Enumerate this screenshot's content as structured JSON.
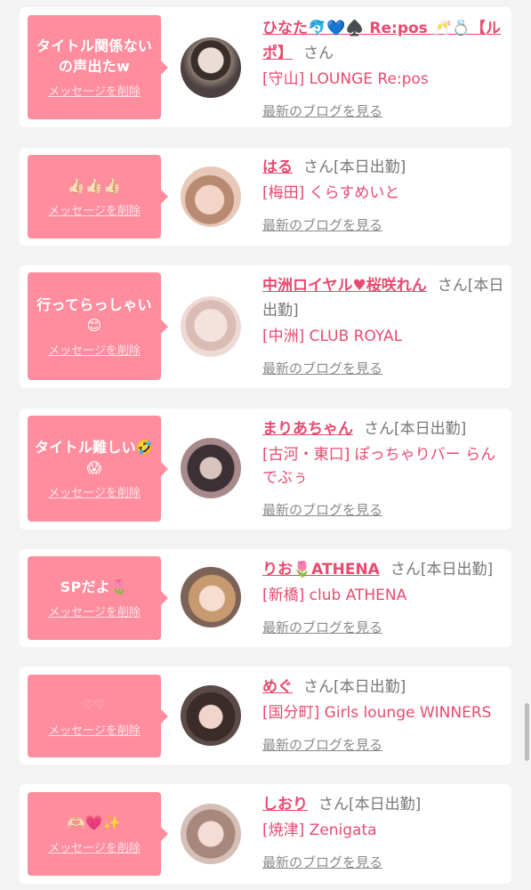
{
  "common": {
    "delete_label": "メッセージを削除",
    "blog_label": "最新のブログを見る",
    "san": "さん"
  },
  "colors": {
    "bubble": "#ff8d9e",
    "name": "#e94a6f",
    "background": "#f3f3f3"
  },
  "messages": [
    {
      "title_lines": [
        "タイトル関係ない",
        "の声出たw"
      ],
      "name": "ひなた🐬💙♠️ Re:pos 🥂💍【ルポ】",
      "status": "",
      "shop": "[守山] LOUNGE Re:pos"
    },
    {
      "title_lines": [
        "👍🏻👍🏻👍🏻"
      ],
      "name": "はる",
      "status": "[本日出勤]",
      "shop": "[梅田] くらすめいと"
    },
    {
      "title_lines": [
        "行ってらっしゃい",
        "😊"
      ],
      "name": "中洲ロイヤル♥桜咲れん",
      "status": "[本日出勤]",
      "shop": "[中洲] CLUB ROYAL"
    },
    {
      "title_lines": [
        "タイトル難しい🤣",
        "😱"
      ],
      "name": "まりあちゃん",
      "status": "[本日出勤]",
      "shop": "[古河・東口] ぽっちゃりバー らんでぶぅ"
    },
    {
      "title_lines": [
        "SPだよ🌷"
      ],
      "name": "りお🌷ATHENA",
      "status": "[本日出勤]",
      "shop": "[新橋] club ATHENA"
    },
    {
      "title_lines": [
        "♡♡"
      ],
      "name": "めぐ",
      "status": "[本日出勤]",
      "shop": "[国分町] Girls lounge WINNERS"
    },
    {
      "title_lines": [
        "🫶🏻💗✨"
      ],
      "name": "しおり",
      "status": "[本日出勤]",
      "shop": "[焼津] Zenigata"
    }
  ]
}
